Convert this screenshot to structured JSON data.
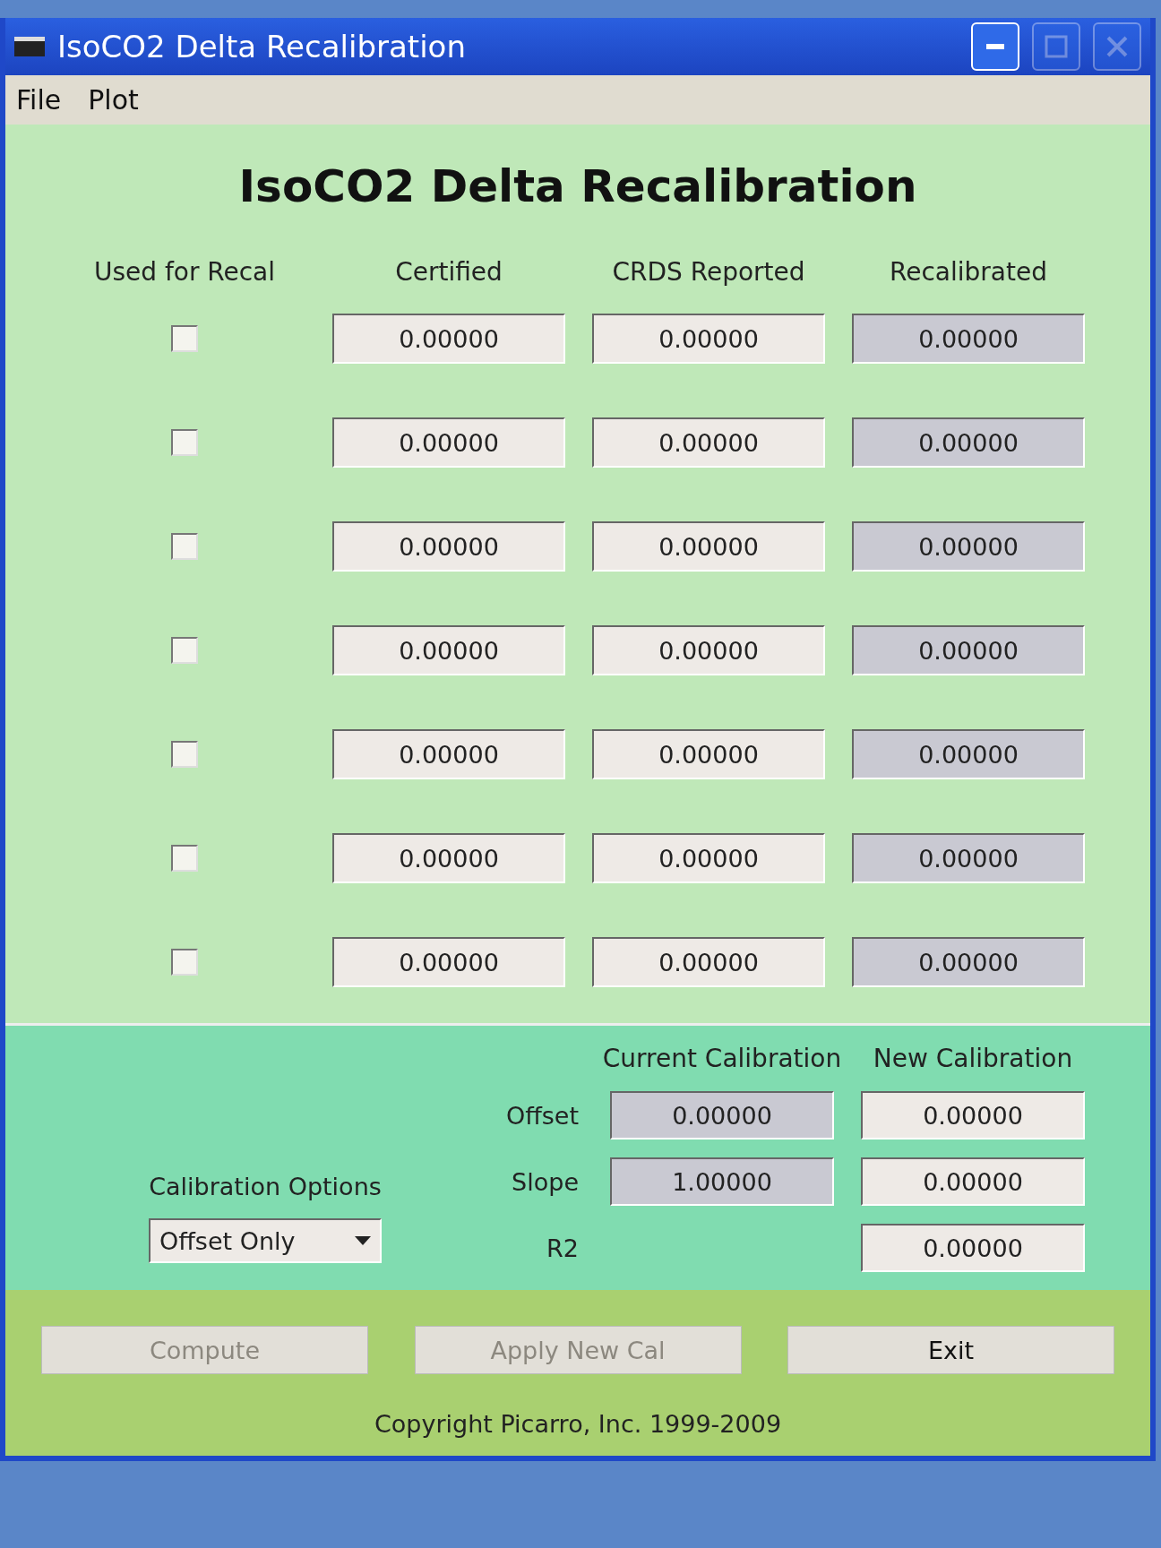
{
  "window": {
    "title": "IsoCO2 Delta Recalibration"
  },
  "menu": [
    "File",
    "Plot"
  ],
  "heading": "IsoCO2 Delta Recalibration",
  "columns": [
    "Used for Recal",
    "Certified",
    "CRDS Reported",
    "Recalibrated"
  ],
  "rows": [
    {
      "checked": false,
      "certified": "0.00000",
      "crds_reported": "0.00000",
      "recalibrated": "0.00000"
    },
    {
      "checked": false,
      "certified": "0.00000",
      "crds_reported": "0.00000",
      "recalibrated": "0.00000"
    },
    {
      "checked": false,
      "certified": "0.00000",
      "crds_reported": "0.00000",
      "recalibrated": "0.00000"
    },
    {
      "checked": false,
      "certified": "0.00000",
      "crds_reported": "0.00000",
      "recalibrated": "0.00000"
    },
    {
      "checked": false,
      "certified": "0.00000",
      "crds_reported": "0.00000",
      "recalibrated": "0.00000"
    },
    {
      "checked": false,
      "certified": "0.00000",
      "crds_reported": "0.00000",
      "recalibrated": "0.00000"
    },
    {
      "checked": false,
      "certified": "0.00000",
      "crds_reported": "0.00000",
      "recalibrated": "0.00000"
    }
  ],
  "calibration": {
    "columns": [
      "Current Calibration",
      "New Calibration"
    ],
    "rows": [
      {
        "label": "Offset",
        "current": "0.00000",
        "new": "0.00000"
      },
      {
        "label": "Slope",
        "current": "1.00000",
        "new": "0.00000"
      },
      {
        "label": "R2",
        "new": "0.00000"
      }
    ]
  },
  "options": {
    "label": "Calibration Options",
    "value": "Offset Only"
  },
  "buttons": [
    {
      "label": "Compute",
      "disabled": true
    },
    {
      "label": "Apply New Cal",
      "disabled": true
    },
    {
      "label": "Exit",
      "disabled": false
    }
  ],
  "copyright": "Copyright Picarro, Inc. 1999-2009"
}
